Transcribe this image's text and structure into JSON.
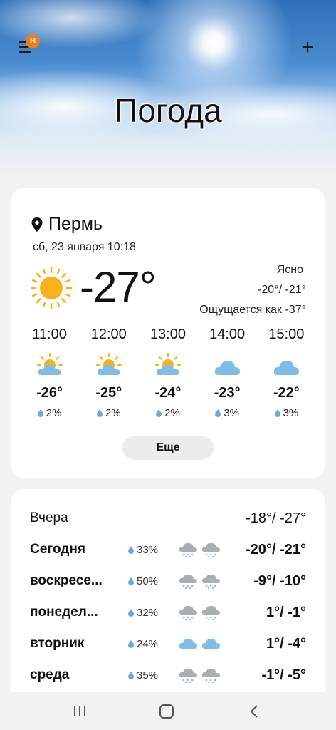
{
  "app": {
    "title": "Погода",
    "menu_badge": "Н",
    "add_label": "+"
  },
  "current": {
    "location": "Пермь",
    "datetime": "сб, 23 января 10:18",
    "temperature": "-27°",
    "condition": "Ясно",
    "high_low": "-20°/ -21°",
    "feels_like": "Ощущается как -37°",
    "icon": "sun-icon"
  },
  "hourly": [
    {
      "time": "11:00",
      "icon": "partly-cloudy-icon",
      "temp": "-26°",
      "precip": "2%"
    },
    {
      "time": "12:00",
      "icon": "partly-cloudy-icon",
      "temp": "-25°",
      "precip": "2%"
    },
    {
      "time": "13:00",
      "icon": "partly-cloudy-icon",
      "temp": "-24°",
      "precip": "2%"
    },
    {
      "time": "14:00",
      "icon": "cloud-icon",
      "temp": "-23°",
      "precip": "3%"
    },
    {
      "time": "15:00",
      "icon": "cloud-icon",
      "temp": "-22°",
      "precip": "3%"
    }
  ],
  "more_button": "Еще",
  "daily": [
    {
      "day": "Вчера",
      "precip": "",
      "icons": [],
      "temps": "-18°/ -27°"
    },
    {
      "day": "Сегодня",
      "precip": "33%",
      "icons": [
        "snow-cloud-icon",
        "snow-cloud-icon"
      ],
      "temps": "-20°/ -21°"
    },
    {
      "day": "воскресе...",
      "precip": "50%",
      "icons": [
        "snow-cloud-icon",
        "snow-cloud-icon"
      ],
      "temps": "-9°/ -10°"
    },
    {
      "day": "понедел...",
      "precip": "32%",
      "icons": [
        "snow-cloud-icon",
        "snow-cloud-icon"
      ],
      "temps": "1°/ -1°"
    },
    {
      "day": "вторник",
      "precip": "24%",
      "icons": [
        "cloud-icon",
        "cloud-icon"
      ],
      "temps": "1°/ -4°"
    },
    {
      "day": "среда",
      "precip": "35%",
      "icons": [
        "snow-cloud-icon",
        "snow-cloud-icon"
      ],
      "temps": "-1°/ -5°"
    }
  ],
  "colors": {
    "accent_badge": "#f07b1d",
    "sun": "#f5b21b",
    "cloud_blue": "#7fbde8",
    "cloud_grey": "#a9aeb3",
    "drop": "#6aa9d8"
  }
}
